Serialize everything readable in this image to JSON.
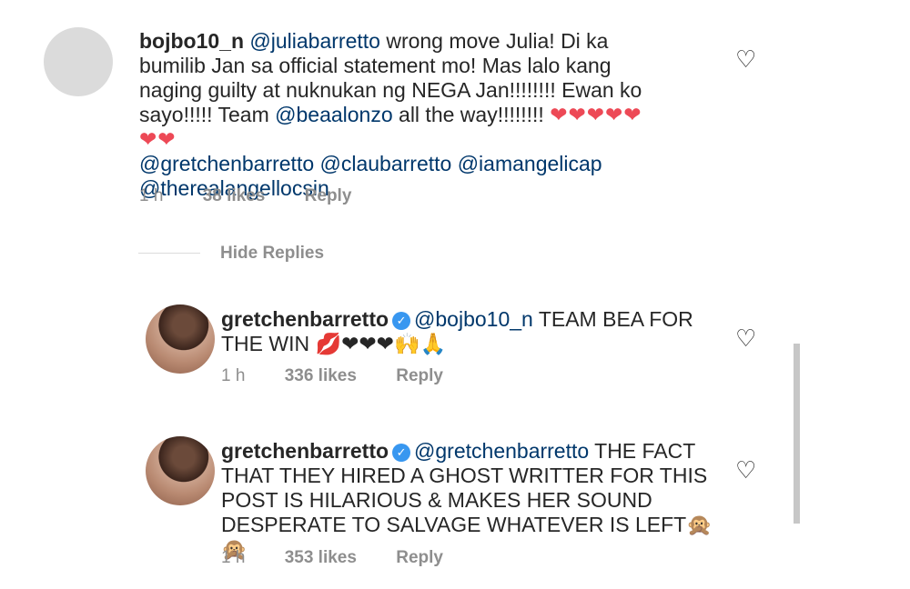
{
  "comment1": {
    "username": "bojbo10_n",
    "mention1": "@juliabarretto",
    "text1": " wrong move Julia! Di ka bumilib Jan sa official statement mo! Mas lalo kang naging guilty at nuknukan ng NEGA Jan!!!!!!!! Ewan ko sayo!!!!! Team ",
    "mention2": "@beaalonzo",
    "text2": " all the way!!!!!!!! ",
    "hearts": "❤❤❤❤❤❤❤",
    "mention3": "@gretchenbarretto @claubarretto  @iamangelicap @therealangellocsin",
    "time": "1 h",
    "likes": "38 likes",
    "reply": "Reply"
  },
  "hide_replies": "Hide Replies",
  "reply1": {
    "username": "gretchenbarretto",
    "verified": "✓",
    "mention": "@bojbo10_n",
    "text": " TEAM BEA FOR THE WIN ",
    "emoji": "💋❤❤❤🙌🙏",
    "time": "1 h",
    "likes": "336 likes",
    "reply": "Reply"
  },
  "reply2": {
    "username": "gretchenbarretto",
    "verified": "✓",
    "mention": "@gretchenbarretto",
    "text": " THE FACT THAT THEY HIRED A GHOST WRITTER FOR THIS POST IS HILARIOUS & MAKES HER SOUND DESPERATE TO SALVAGE WHATEVER IS LEFT",
    "emoji": "🙊🙊",
    "time": "1 h",
    "likes": "353 likes",
    "reply": "Reply"
  },
  "icons": {
    "like": "heart-outline-icon",
    "verified": "verified-badge-icon"
  }
}
